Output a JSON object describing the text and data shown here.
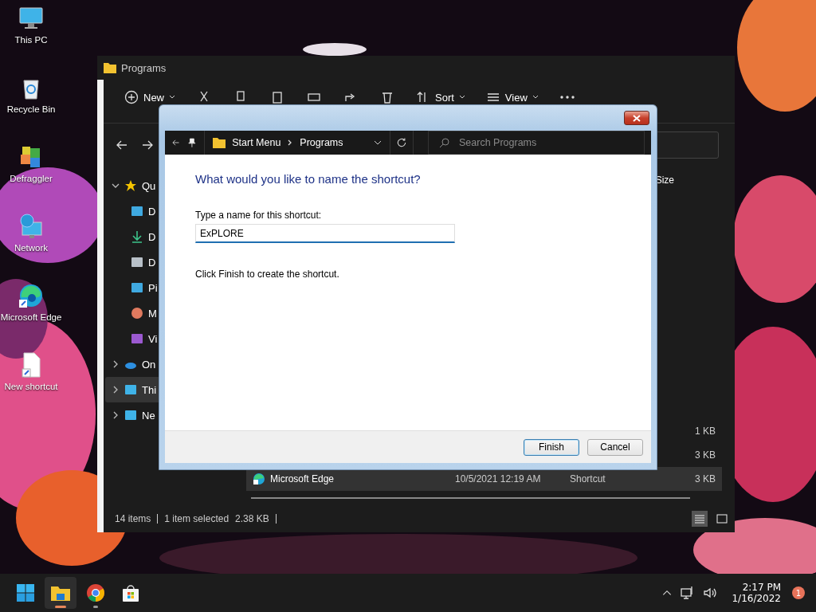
{
  "desktop_icons": [
    {
      "kind": "pc",
      "label": "This PC"
    },
    {
      "kind": "recycle",
      "label": "Recycle Bin"
    },
    {
      "kind": "defraggler",
      "label": "Defraggler"
    },
    {
      "kind": "network",
      "label": "Network"
    },
    {
      "kind": "edge",
      "label": "Microsoft Edge"
    },
    {
      "kind": "file",
      "label": "New shortcut"
    }
  ],
  "explorer": {
    "title": "Programs",
    "toolbar": [
      {
        "kind": "new",
        "label": "New"
      },
      {
        "kind": "sort",
        "label": "Sort"
      },
      {
        "kind": "view",
        "label": "View"
      }
    ],
    "sidebar": [
      {
        "kind": "star",
        "label": "Qu",
        "expanded": true,
        "selected": false,
        "children": [
          {
            "kind": "desktop",
            "label": "D",
            "selected": false
          },
          {
            "kind": "download",
            "label": "D",
            "selected": false
          },
          {
            "kind": "document",
            "label": "D",
            "selected": false
          },
          {
            "kind": "pictures",
            "label": "Pi",
            "selected": false
          },
          {
            "kind": "music",
            "label": "M",
            "selected": false
          },
          {
            "kind": "videos",
            "label": "Vi",
            "selected": false
          }
        ]
      },
      {
        "kind": "cloud",
        "label": "On",
        "expanded": false,
        "selected": false
      },
      {
        "kind": "pc",
        "label": "Thi",
        "expanded": false,
        "selected": true
      },
      {
        "kind": "network",
        "label": "Ne",
        "expanded": false,
        "selected": false
      }
    ],
    "columns": [
      {
        "label": "Size"
      }
    ],
    "rows": [
      {
        "size": "1 KB",
        "selected": false
      },
      {
        "size": "3 KB",
        "selected": false
      },
      {
        "name": "Microsoft Edge",
        "date": "10/5/2021 12:19 AM",
        "type": "Shortcut",
        "size": "3 KB",
        "selected": true
      }
    ],
    "status": {
      "count": "14 items",
      "selection": "1 item selected",
      "size": "2.38 KB"
    },
    "views": [
      {
        "kind": "details",
        "selected": true
      },
      {
        "kind": "tiles",
        "selected": false
      }
    ]
  },
  "dialog": {
    "path": [
      "Start Menu",
      "Programs"
    ],
    "search_placeholder": "Search Programs",
    "heading": "What would you like to name the shortcut?",
    "field_label": "Type a name for this shortcut:",
    "field_value": "ExPLORE",
    "instruction": "Click Finish to create the shortcut.",
    "buttons": [
      {
        "label": "Finish",
        "default": true
      },
      {
        "label": "Cancel",
        "default": false
      }
    ]
  },
  "taskbar": {
    "apps": [
      {
        "kind": "start",
        "active": false,
        "running": false
      },
      {
        "kind": "explorer",
        "active": true,
        "running": true
      },
      {
        "kind": "chrome",
        "active": false,
        "running": true
      },
      {
        "kind": "store",
        "active": false,
        "running": false
      }
    ],
    "time": "2:17 PM",
    "date": "1/16/2022",
    "notifications": "1"
  }
}
